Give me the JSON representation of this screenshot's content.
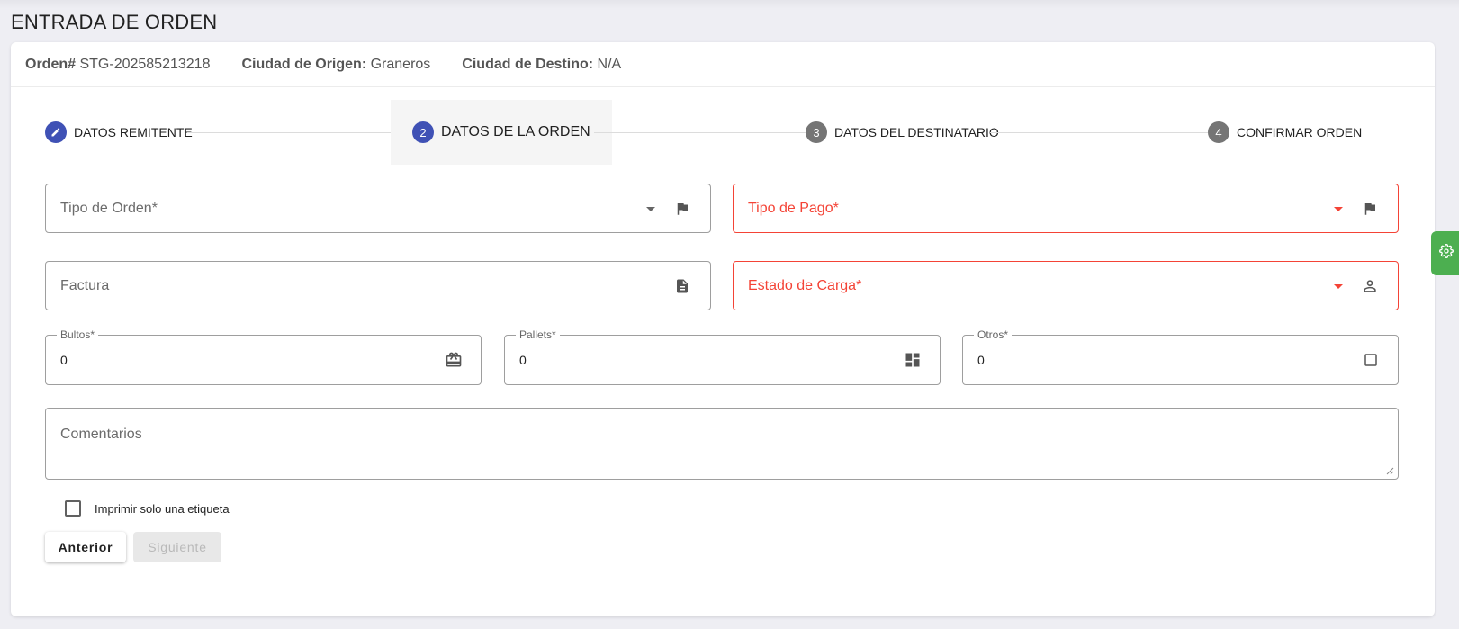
{
  "page_title": "ENTRADA DE ORDEN",
  "info": {
    "order_label": "Orden#",
    "order_value": "STG-202585213218",
    "origin_label": "Ciudad de Origen:",
    "origin_value": "Graneros",
    "dest_label": "Ciudad de Destino:",
    "dest_value": "N/A"
  },
  "steps": [
    {
      "number": "",
      "label": "DATOS REMITENTE",
      "state": "edit"
    },
    {
      "number": "2",
      "label": "DATOS DE LA ORDEN",
      "state": "active"
    },
    {
      "number": "3",
      "label": "DATOS DEL DESTINATARIO",
      "state": "pending"
    },
    {
      "number": "4",
      "label": "CONFIRMAR ORDEN",
      "state": "pending"
    }
  ],
  "form": {
    "tipo_orden": {
      "placeholder": "Tipo de Orden*",
      "icon": "flag-icon"
    },
    "tipo_pago": {
      "placeholder": "Tipo de Pago*",
      "icon": "flag-icon",
      "error": true
    },
    "factura": {
      "placeholder": "Factura",
      "icon": "document-icon"
    },
    "estado_carga": {
      "placeholder": "Estado de Carga*",
      "icon": "person-icon",
      "error": true
    },
    "bultos": {
      "label": "Bultos*",
      "value": "0",
      "icon": "gift-card-icon"
    },
    "pallets": {
      "label": "Pallets*",
      "value": "0",
      "icon": "dashboard-icon"
    },
    "otros": {
      "label": "Otros*",
      "value": "0",
      "icon": "square-icon"
    },
    "comentarios": {
      "placeholder": "Comentarios"
    },
    "checkbox_label": "Imprimir solo una etiqueta"
  },
  "buttons": {
    "prev": "Anterior",
    "next": "Siguiente"
  },
  "colors": {
    "primary": "#3f51b5",
    "error": "#f44336",
    "settings": "#4caf50"
  }
}
